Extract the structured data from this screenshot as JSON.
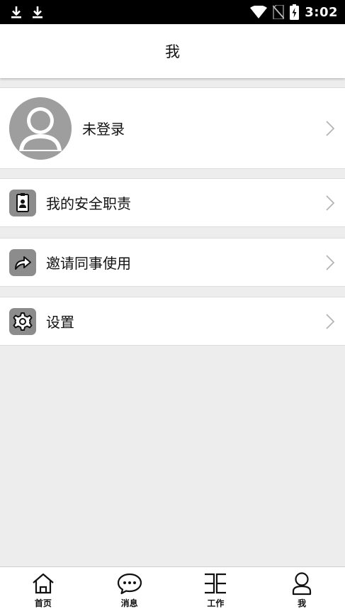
{
  "status_bar": {
    "time": "3:02",
    "icons": [
      "download-icon",
      "download-icon",
      "wifi-icon",
      "no-sim-icon",
      "battery-charging-icon"
    ]
  },
  "header": {
    "title": "我"
  },
  "profile": {
    "name": "未登录",
    "avatar_icon": "default-avatar-icon"
  },
  "menu": {
    "items": [
      {
        "label": "我的安全职责",
        "icon": "id-badge-icon"
      },
      {
        "label": "邀请同事使用",
        "icon": "share-arrow-icon"
      },
      {
        "label": "设置",
        "icon": "gear-icon"
      }
    ]
  },
  "bottom_nav": {
    "items": [
      {
        "label": "首页",
        "icon": "home-icon"
      },
      {
        "label": "消息",
        "icon": "chat-bubble-icon"
      },
      {
        "label": "工作",
        "icon": "work-grid-icon"
      },
      {
        "label": "我",
        "icon": "person-icon"
      }
    ],
    "active": "我"
  },
  "colors": {
    "status_bar": "#000000",
    "background": "#ededed",
    "icon_tile": "#8c8c8c",
    "avatar": "#9e9e9e",
    "chevron": "#b5b5b5"
  }
}
